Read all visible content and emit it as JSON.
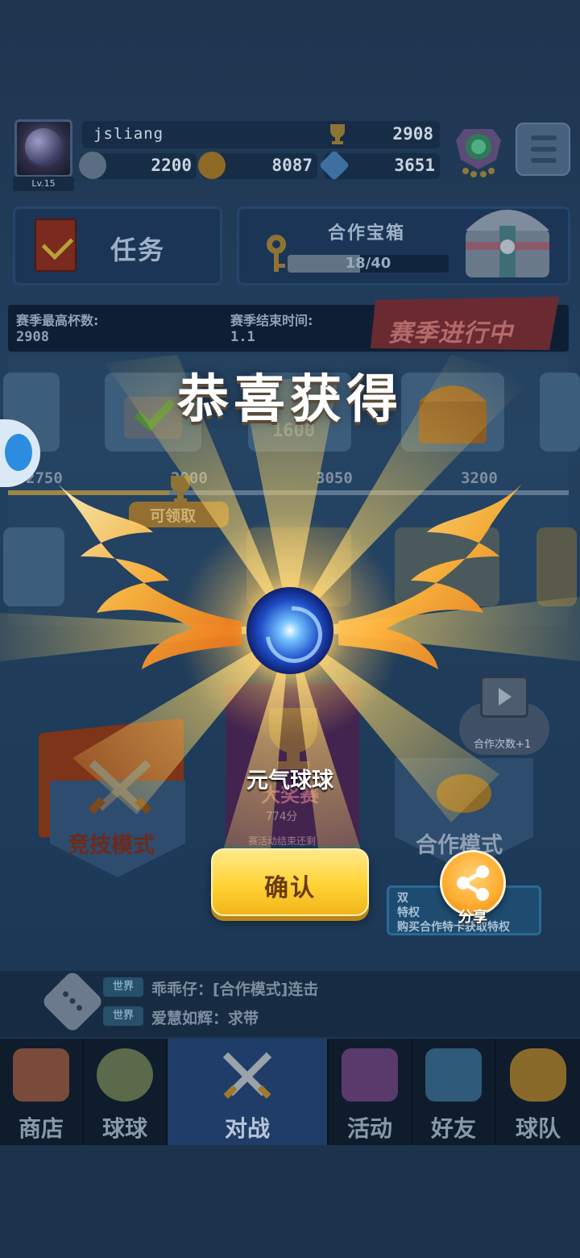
{
  "player": {
    "name": "jsliang",
    "level": "Lv.15",
    "trophies": "2908",
    "resources": [
      "2200",
      "8087",
      "3651"
    ]
  },
  "tasks": {
    "label": "任务"
  },
  "coop_chest": {
    "title": "合作宝箱",
    "progress_text": "18/40",
    "progress_fraction": 0.45
  },
  "season": {
    "best_label": "赛季最高杯数:",
    "best_value": "2908",
    "end_label": "赛季结束时间:",
    "end_value": "1.1",
    "status": "赛季进行中"
  },
  "track": {
    "milestones": [
      "2750",
      "2900",
      "3050",
      "3200"
    ],
    "reward_value": "1600",
    "claim_label": "可领取"
  },
  "modes": {
    "competitive": "竞技模式",
    "tournament_title": "大奖赛",
    "tournament_score": "774分",
    "tournament_note": "赛活动结束还剩",
    "coop": "合作模式",
    "coop_times": "合作次数+1",
    "privilege_lines": [
      "双",
      "特权",
      "购买合作特卡获取特权"
    ]
  },
  "reward": {
    "title": "恭喜获得",
    "item_name": "元气球球",
    "confirm_label": "确认",
    "share_label": "分享"
  },
  "chat": [
    {
      "channel": "世界",
      "text": "乖乖仔：[合作模式]连击"
    },
    {
      "channel": "世界",
      "text": "爱慧如辉：求带"
    }
  ],
  "nav": [
    {
      "label": "商店",
      "icon": "shop-icon",
      "active": false
    },
    {
      "label": "球球",
      "icon": "ball-icon",
      "active": false
    },
    {
      "label": "对战",
      "icon": "swords-icon",
      "active": true
    },
    {
      "label": "活动",
      "icon": "party-popper-icon",
      "active": false
    },
    {
      "label": "好友",
      "icon": "friends-book-icon",
      "active": false
    },
    {
      "label": "球队",
      "icon": "whistle-icon",
      "active": false
    }
  ],
  "colors": {
    "accent_gold": "#ffd234",
    "ray_gold": "#ffd86a",
    "wing_orange": "#ff9a2a",
    "nav_active": "#1f3d68"
  }
}
